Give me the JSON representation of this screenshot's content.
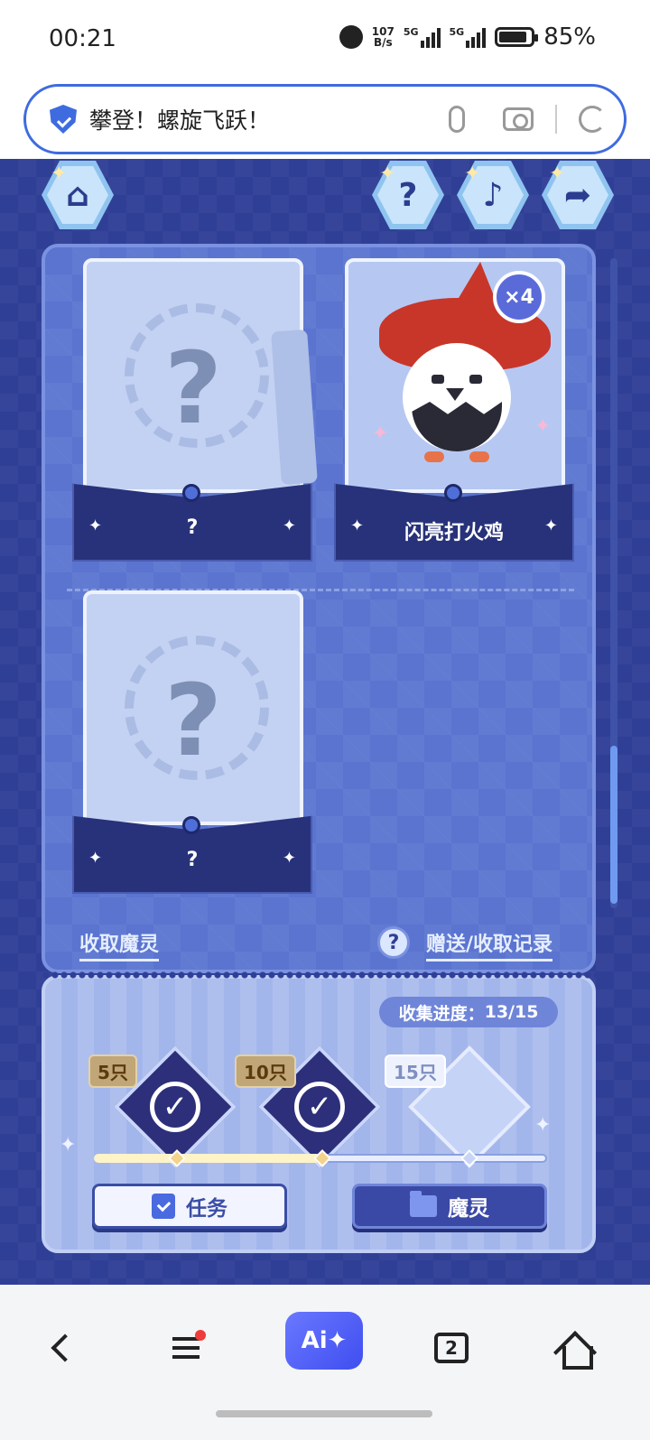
{
  "status_bar": {
    "time": "00:21",
    "net_speed_value": "107",
    "net_speed_unit": "B/s",
    "sim1_label": "5G",
    "sim2_label": "5G",
    "battery_percent": "85%",
    "battery_level": 0.85
  },
  "search": {
    "title": "攀登！螺旋飞跃！"
  },
  "game": {
    "cards": [
      {
        "name": "?",
        "collected": false
      },
      {
        "name": "闪亮打火鸡",
        "collected": true,
        "count_badge": "×4"
      },
      {
        "name": "?",
        "collected": false
      }
    ],
    "links": {
      "collect": "收取魔灵",
      "records": "赠送/收取记录",
      "help_icon": "?"
    },
    "progress": {
      "label": "收集进度：",
      "value": "13/15",
      "fill_fraction": 0.5
    },
    "milestones": [
      {
        "label": "5只",
        "claimed": true
      },
      {
        "label": "10只",
        "claimed": true
      },
      {
        "label": "15只",
        "claimed": false
      }
    ],
    "buttons": {
      "task": "任务",
      "spirit": "魔灵"
    }
  },
  "bottom_nav": {
    "ai_label": "Ai✦",
    "tab_count": "2"
  },
  "colors": {
    "accent": "#3f6be0",
    "game_bg": "#2f3f96",
    "panel": "#5a74d0",
    "ai_button": "#4f5ef4",
    "notification_dot": "#ee3b3b"
  }
}
